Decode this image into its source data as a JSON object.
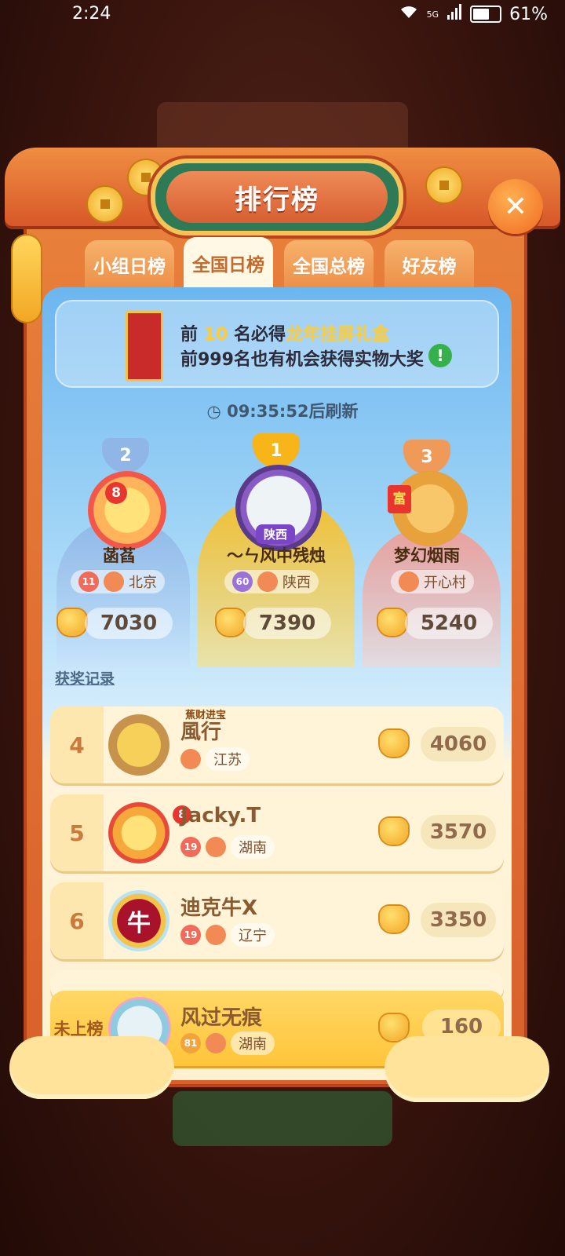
{
  "status_bar": {
    "time": "2:24",
    "network": "5G",
    "battery": "61%"
  },
  "title": "排行榜",
  "tabs": [
    {
      "label": "小组日榜",
      "active": false
    },
    {
      "label": "全国日榜",
      "active": true
    },
    {
      "label": "全国总榜",
      "active": false
    },
    {
      "label": "好友榜",
      "active": false
    }
  ],
  "banner": {
    "line1_prefix": "前",
    "line1_number": "10",
    "line1_middle": "名必得",
    "line1_highlight": "龙年挂屏礼盒",
    "line2": "前999名也有机会获得实物大奖",
    "info_icon": "!"
  },
  "refresh_timer": "09:35:52后刷新",
  "podium": [
    {
      "rank": "2",
      "name": "菡萏",
      "level": "11",
      "region": "北京",
      "score": "7030",
      "avatar_badge": "8"
    },
    {
      "rank": "1",
      "name": "〜ㄣ风中残烛",
      "level": "60",
      "region": "陕西",
      "score": "7390",
      "tag": "陕西"
    },
    {
      "rank": "3",
      "name": "梦幻烟雨",
      "region": "开心村",
      "score": "5240",
      "avatar_badge": "富"
    }
  ],
  "record_link": "获奖记录",
  "list": [
    {
      "rank": "4",
      "name": "風行",
      "region": "江苏",
      "score": "4060",
      "avatar_text": "蕉财进宝"
    },
    {
      "rank": "5",
      "name": "Jacky.T",
      "level": "19",
      "region": "湖南",
      "score": "3570",
      "avatar_badge": "8"
    },
    {
      "rank": "6",
      "name": "迪克牛X",
      "level": "19",
      "region": "辽宁",
      "score": "3350",
      "avatar_text": "牛"
    }
  ],
  "my_entry": {
    "rank_label": "未上榜",
    "name": "风过无痕",
    "level": "81",
    "region": "湖南",
    "score": "160"
  },
  "colors": {
    "frame": "#d9602a",
    "plaque": "#2f7a56",
    "gold": "#f3a524",
    "rank1": "#f7b51a",
    "rank2": "#8fb6e6",
    "rank3": "#f09a5a"
  }
}
